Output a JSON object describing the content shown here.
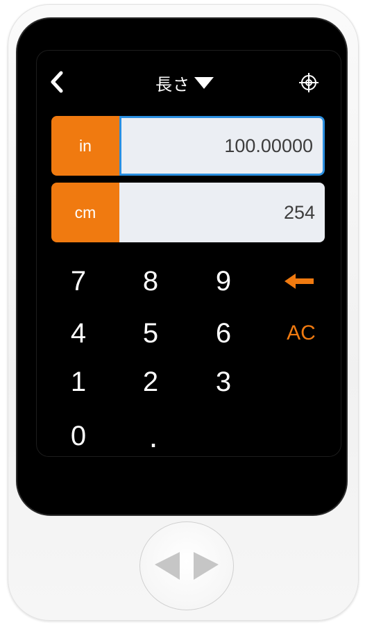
{
  "header": {
    "title": "長さ",
    "back_icon": "chevron-left-icon",
    "dropdown_icon": "caret-down-icon",
    "right_icon": "crosshair-target-icon"
  },
  "converter": {
    "rows": [
      {
        "unit": "in",
        "value": "100.00000",
        "active": true
      },
      {
        "unit": "cm",
        "value": "254",
        "active": false
      }
    ]
  },
  "keypad": {
    "keys": [
      "7",
      "8",
      "9",
      "4",
      "5",
      "6",
      "1",
      "2",
      "3",
      "0",
      "."
    ],
    "clear_label": "AC",
    "backspace_icon": "backspace-arrow-icon"
  },
  "colors": {
    "accent": "#f07a10",
    "active_border": "#2b8fe0",
    "field_bg": "#ebeef3",
    "screen_bg": "#000000"
  },
  "device": {
    "home_button_icon": "logo-triangles-icon"
  }
}
